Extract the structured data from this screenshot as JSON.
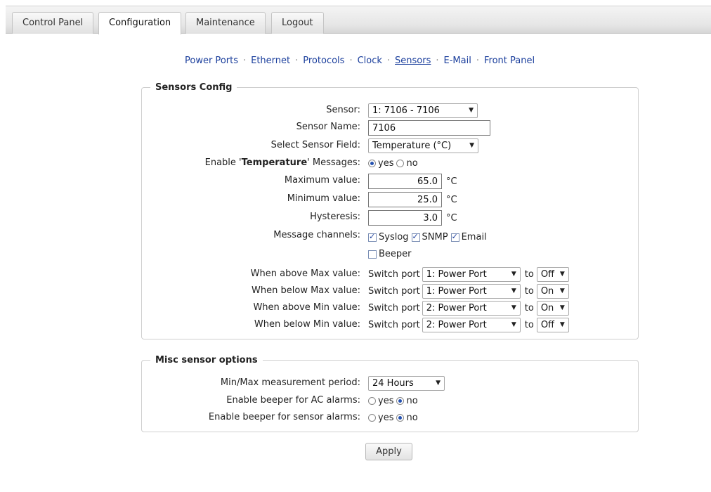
{
  "tabs": [
    "Control Panel",
    "Configuration",
    "Maintenance",
    "Logout"
  ],
  "subnav": [
    "Power Ports",
    "Ethernet",
    "Protocols",
    "Clock",
    "Sensors",
    "E-Mail",
    "Front Panel"
  ],
  "subnav_separator": "·",
  "sensors_config": {
    "legend": "Sensors Config",
    "sensor": {
      "label": "Sensor:",
      "value": "1: 7106 - 7106"
    },
    "sensor_name": {
      "label": "Sensor Name:",
      "value": "7106"
    },
    "sensor_field": {
      "label": "Select Sensor Field:",
      "value": "Temperature (°C)"
    },
    "enable_messages": {
      "label_pre": "Enable '",
      "label_bold": "Temperature",
      "label_post": "' Messages:",
      "yes": "yes",
      "no": "no",
      "selected": "yes"
    },
    "max_value": {
      "label": "Maximum value:",
      "value": "65.0",
      "unit": "°C"
    },
    "min_value": {
      "label": "Minimum value:",
      "value": "25.0",
      "unit": "°C"
    },
    "hysteresis": {
      "label": "Hysteresis:",
      "value": "3.0",
      "unit": "°C"
    },
    "channels": {
      "label": "Message channels:",
      "syslog": "Syslog",
      "snmp": "SNMP",
      "email": "Email",
      "beeper": "Beeper",
      "checked": {
        "syslog": true,
        "snmp": true,
        "email": true,
        "beeper": false
      }
    },
    "actions": [
      {
        "label": "When above Max value:",
        "prefix": "Switch port",
        "port": "1: Power Port",
        "to": "to",
        "state": "Off"
      },
      {
        "label": "When below Max value:",
        "prefix": "Switch port",
        "port": "1: Power Port",
        "to": "to",
        "state": "On"
      },
      {
        "label": "When above Min value:",
        "prefix": "Switch port",
        "port": "2: Power Port",
        "to": "to",
        "state": "On"
      },
      {
        "label": "When below Min value:",
        "prefix": "Switch port",
        "port": "2: Power Port",
        "to": "to",
        "state": "Off"
      }
    ]
  },
  "misc": {
    "legend": "Misc sensor options",
    "period": {
      "label": "Min/Max measurement period:",
      "value": "24 Hours"
    },
    "beeper_ac": {
      "label": "Enable beeper for AC alarms:",
      "yes": "yes",
      "no": "no",
      "selected": "no"
    },
    "beeper_sensor": {
      "label": "Enable beeper for sensor alarms:",
      "yes": "yes",
      "no": "no",
      "selected": "no"
    }
  },
  "apply_label": "Apply"
}
